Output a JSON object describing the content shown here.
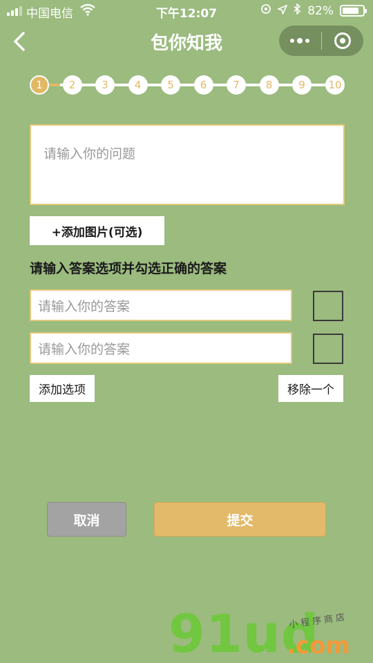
{
  "status_bar": {
    "carrier": "中国电信",
    "time": "下午12:07",
    "battery": "82%",
    "battery_level": 0.82
  },
  "nav": {
    "title": "包你知我",
    "back_icon": "chevron-left-icon",
    "more_icon": "more-dots-icon",
    "close_icon": "target-circle-icon"
  },
  "steps": {
    "items": [
      "1",
      "2",
      "3",
      "4",
      "5",
      "6",
      "7",
      "8",
      "9",
      "10"
    ],
    "current": 1
  },
  "question": {
    "placeholder": "请输入你的问题"
  },
  "add_image_label": "+添加图片(可选)",
  "instruction": "请输入答案选项并勾选正确的答案",
  "answers": [
    {
      "placeholder": "请输入你的答案",
      "checked": false
    },
    {
      "placeholder": "请输入你的答案",
      "checked": false
    }
  ],
  "add_option_label": "添加选项",
  "remove_one_label": "移除一个",
  "cancel_label": "取消",
  "submit_label": "提交",
  "watermark": {
    "main": "91ud",
    "suffix": ".com",
    "tagline": "小程序商店"
  },
  "colors": {
    "background": "#9bbb7f",
    "accent": "#e3b865",
    "cancel": "#a3a3a3"
  }
}
